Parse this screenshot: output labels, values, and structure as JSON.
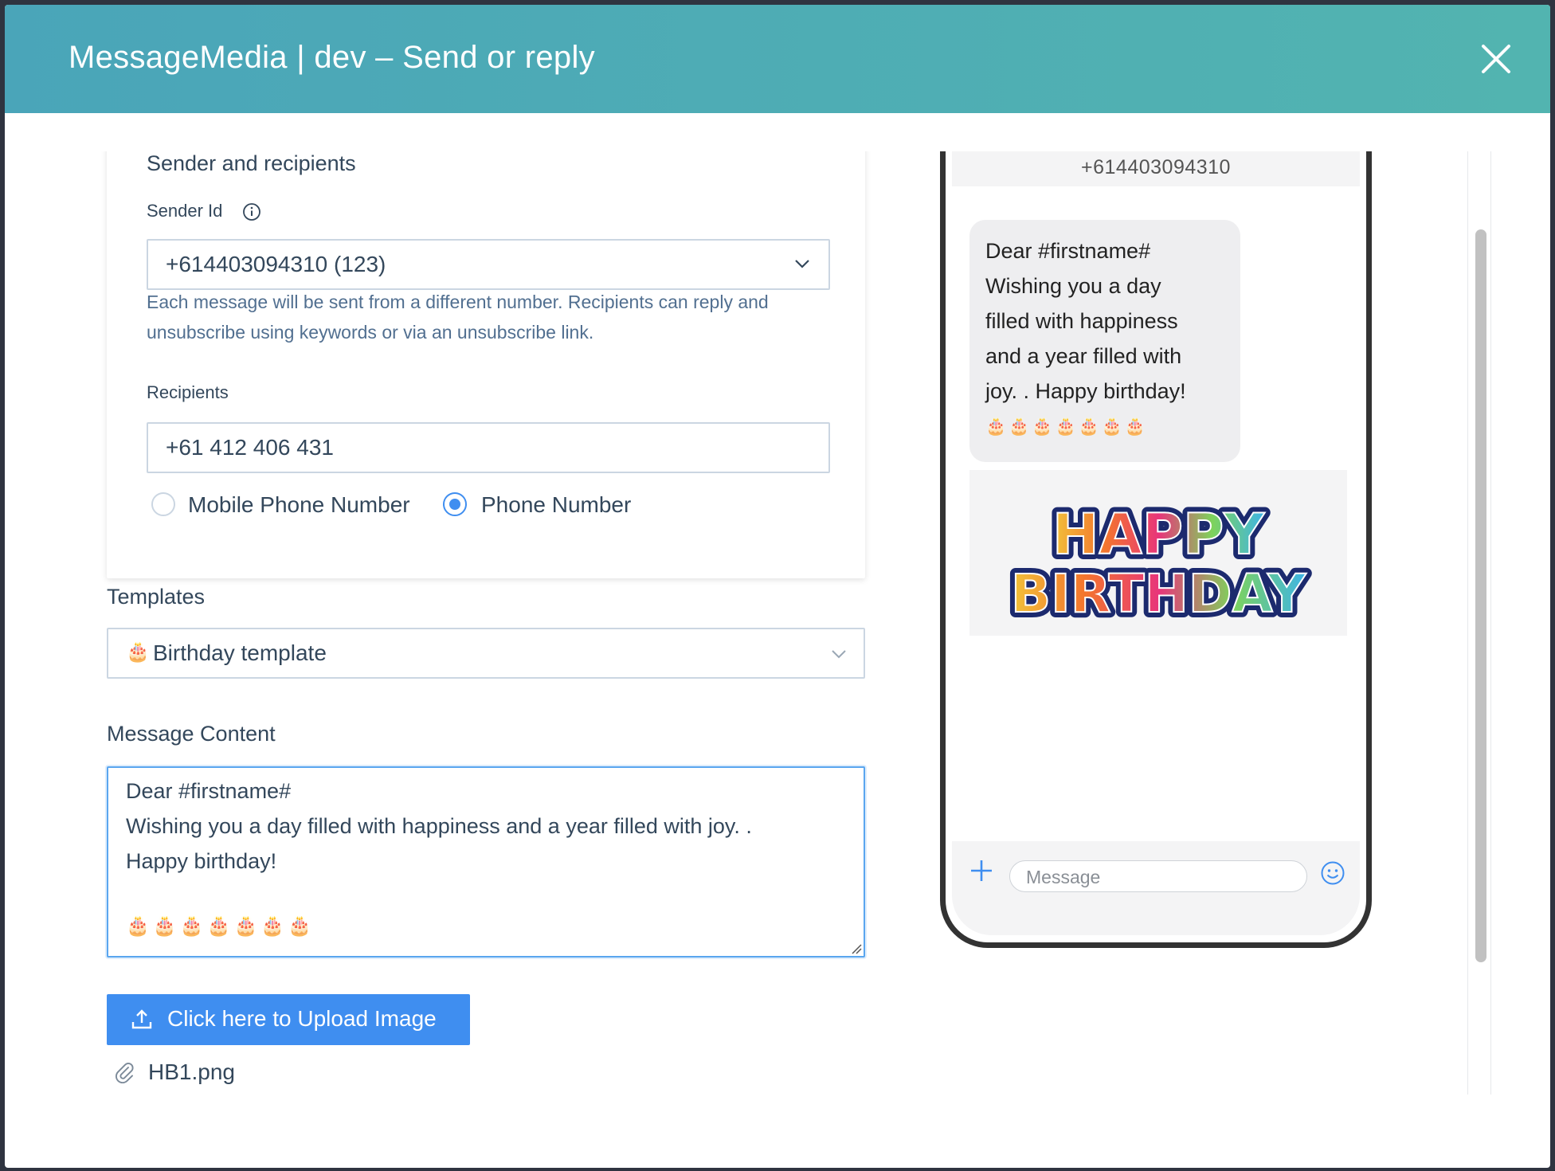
{
  "window": {
    "title": "MessageMedia | dev – Send or reply"
  },
  "sender": {
    "section_heading": "Sender and recipients",
    "sender_id_label": "Sender Id",
    "sender_id_value": "+614403094310 (123)",
    "help_text": "Each message will be sent from a different number. Recipients can reply and unsubscribe using keywords or via an unsubscribe link.",
    "recipients_label": "Recipients",
    "recipients_value": "+61 412 406 431",
    "radio_options": [
      {
        "label": "Mobile Phone Number",
        "checked": false
      },
      {
        "label": "Phone Number",
        "checked": true
      }
    ]
  },
  "templates": {
    "label": "Templates",
    "selected_icon": "🎂",
    "selected_value": "Birthday template"
  },
  "message": {
    "label": "Message Content",
    "lines": [
      "Dear #firstname#",
      "Wishing you a day filled with happiness and a year filled with joy. .",
      "Happy birthday!"
    ],
    "cakes": "🎂🎂🎂🎂🎂🎂🎂"
  },
  "upload": {
    "button_label": "Click here to Upload Image",
    "attachment_name": "HB1.png"
  },
  "preview": {
    "phone_number": "+614403094310",
    "bubble_lines": [
      "Dear #firstname#",
      "Wishing you a day",
      "filled with happiness",
      "and a year filled with",
      "joy. . Happy birthday!"
    ],
    "bubble_cakes": "🎂🎂🎂🎂🎂🎂🎂",
    "image_text_line1": "HAPPY",
    "image_text_line2": "BIRTHDAY",
    "message_placeholder": "Message"
  },
  "colors": {
    "header_start": "#4aa5b9",
    "header_end": "#52b4b0",
    "primary": "#3f8ef0",
    "text": "#33475b"
  }
}
